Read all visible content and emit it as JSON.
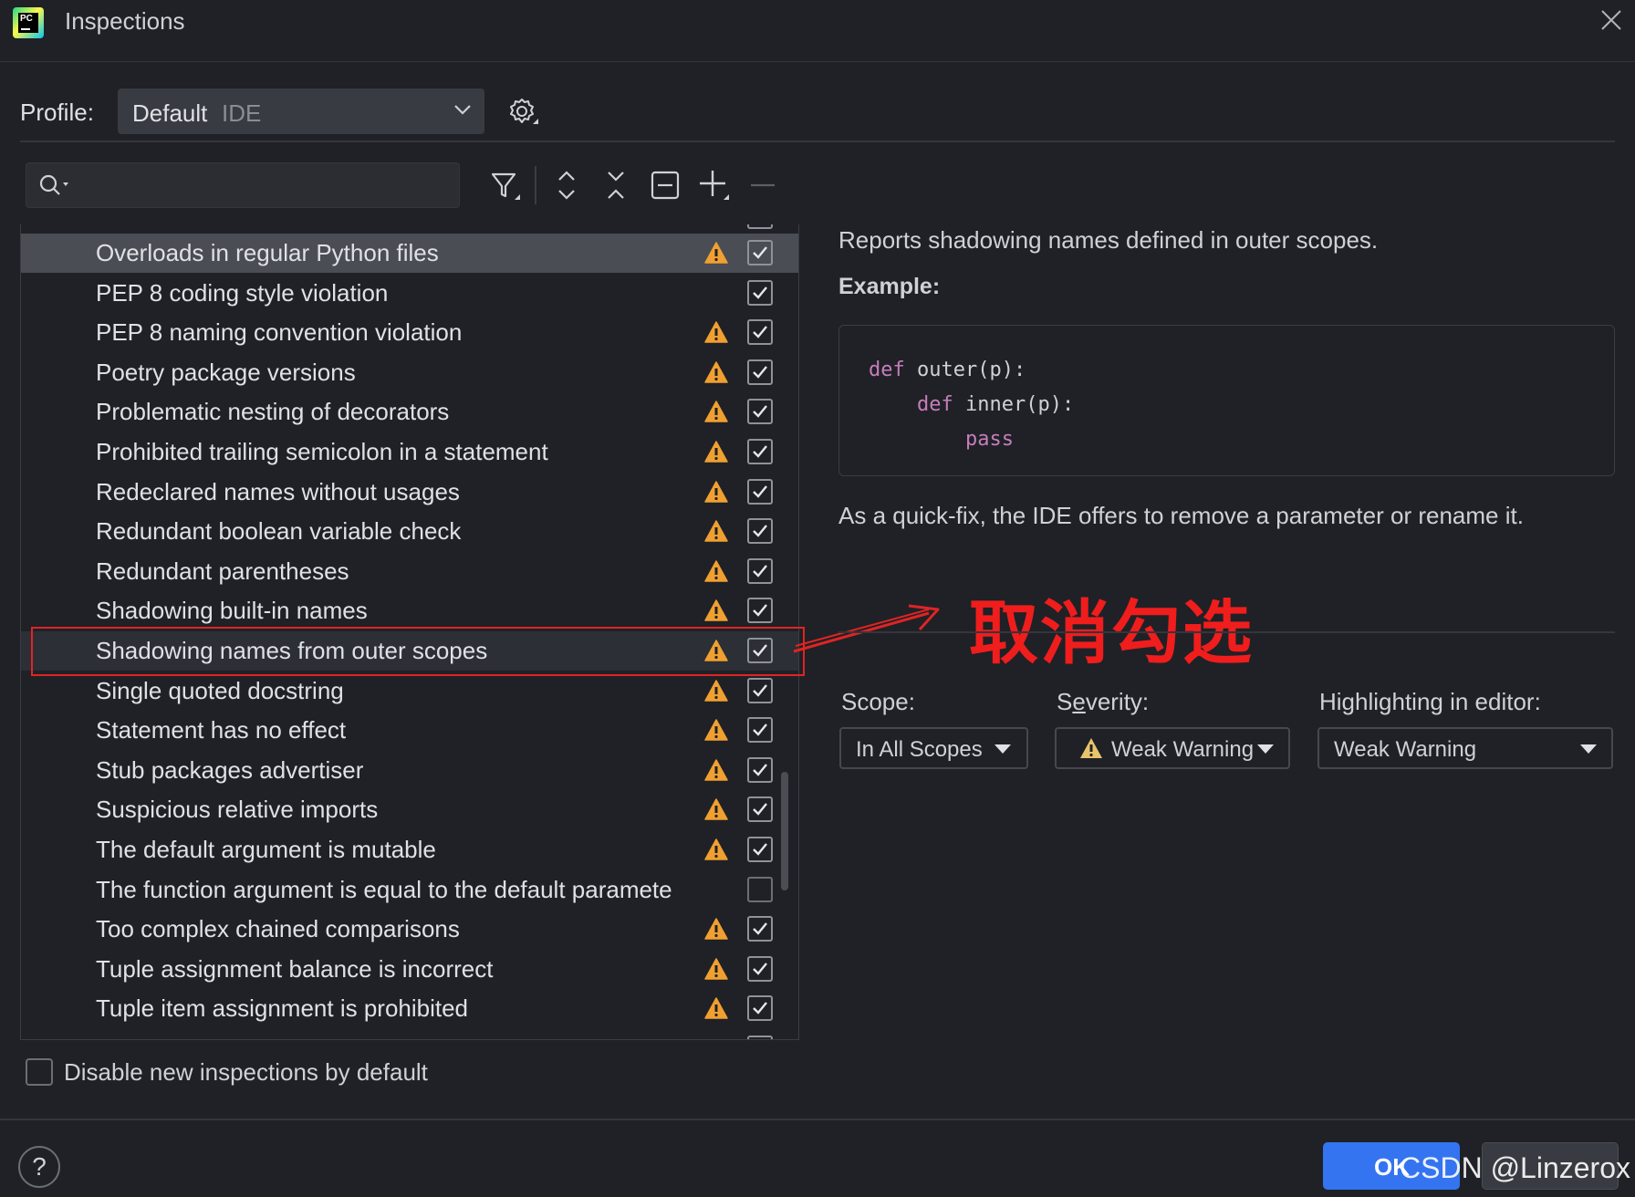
{
  "window": {
    "title": "Inspections"
  },
  "profile": {
    "label": "Profile:",
    "value": "Default",
    "sub": "IDE"
  },
  "search": {
    "placeholder": ""
  },
  "inspections": [
    {
      "label": "Overloads in regular Python files",
      "warn": true,
      "checked": true,
      "selected": true
    },
    {
      "label": "PEP 8 coding style violation",
      "warn": false,
      "checked": true
    },
    {
      "label": "PEP 8 naming convention violation",
      "warn": true,
      "checked": true
    },
    {
      "label": "Poetry package versions",
      "warn": true,
      "checked": true
    },
    {
      "label": "Problematic nesting of decorators",
      "warn": true,
      "checked": true
    },
    {
      "label": "Prohibited trailing semicolon in a statement",
      "warn": true,
      "checked": true
    },
    {
      "label": "Redeclared names without usages",
      "warn": true,
      "checked": true
    },
    {
      "label": "Redundant boolean variable check",
      "warn": true,
      "checked": true
    },
    {
      "label": "Redundant parentheses",
      "warn": true,
      "checked": true
    },
    {
      "label": "Shadowing built-in names",
      "warn": true,
      "checked": true
    },
    {
      "label": "Shadowing names from outer scopes",
      "warn": true,
      "checked": true,
      "highlight": true
    },
    {
      "label": "Single quoted docstring",
      "warn": true,
      "checked": true
    },
    {
      "label": "Statement has no effect",
      "warn": true,
      "checked": true
    },
    {
      "label": "Stub packages advertiser",
      "warn": true,
      "checked": true
    },
    {
      "label": "Suspicious relative imports",
      "warn": true,
      "checked": true
    },
    {
      "label": "The default argument is mutable",
      "warn": true,
      "checked": true
    },
    {
      "label": "The function argument is equal to the default paramete",
      "warn": false,
      "checked": false
    },
    {
      "label": "Too complex chained comparisons",
      "warn": true,
      "checked": true
    },
    {
      "label": "Tuple assignment balance is incorrect",
      "warn": true,
      "checked": true
    },
    {
      "label": "Tuple item assignment is prohibited",
      "warn": true,
      "checked": true
    }
  ],
  "description": {
    "summary": "Reports shadowing names defined in outer scopes.",
    "example_heading": "Example:",
    "code": {
      "line1_kw": "def",
      "line1_rest": " outer(p):",
      "line2_kw": "def",
      "line2_rest": " inner(p):",
      "line3_kw": "pass"
    },
    "quickfix": "As a quick-fix, the IDE offers to remove a parameter or rename it."
  },
  "annotation": {
    "text": "取消勾选",
    "color": "#f01d1d"
  },
  "options": {
    "scope_label": "Scope:",
    "scope_value": "In All Scopes",
    "severity_label_pre": "S",
    "severity_label_u": "e",
    "severity_label_post": "verity:",
    "severity_value": "Weak Warning",
    "highlight_label": "Highlighting in editor:",
    "highlight_value": "Weak Warning"
  },
  "footer": {
    "disable_label": "Disable new inspections by default",
    "help": "?",
    "ok": "OK",
    "watermark": "CSDN @Linzerox"
  },
  "colors": {
    "accent": "#3574f0",
    "warning": "#f0a030",
    "annotation_red": "#e02424"
  }
}
